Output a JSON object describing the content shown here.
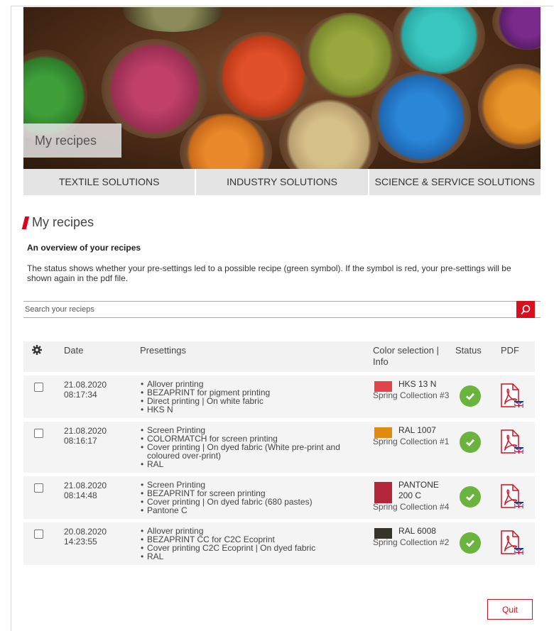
{
  "hero": {
    "title": "My recipes"
  },
  "nav": {
    "items": [
      "TEXTILE SOLUTIONS",
      "INDUSTRY SOLUTIONS",
      "SCIENCE & SERVICE SOLUTIONS"
    ]
  },
  "page": {
    "heading": "My recipes",
    "subtitle": "An overview of your recipes",
    "description": "The status shows whether your pre-settings led to a possible recipe (green symbol). If the symbol is red, your pre-settings will be shown again in the pdf file."
  },
  "search": {
    "placeholder": "Search your recieps",
    "icon": "search-icon"
  },
  "table": {
    "headers": {
      "settings_icon": "gear-icon",
      "date": "Date",
      "presettings": "Presettings",
      "color": "Color selection | Info",
      "status": "Status",
      "pdf": "PDF"
    },
    "rows": [
      {
        "date": "21.08.2020",
        "time": "08:17:34",
        "presettings": [
          "Allover printing",
          "BEZAPRINT for pigment printing",
          "Direct printing | On white fabric",
          "HKS N"
        ],
        "color_code": "HKS 13 N",
        "color_hex": "#e0434a",
        "collection": "Spring Collection #3",
        "status": "ok"
      },
      {
        "date": "21.08.2020",
        "time": "08:16:17",
        "presettings": [
          "Screen Printing",
          "COLORMATCH for screen printing",
          "Cover printing | On dyed fabric (White pre-print and coloured over-print)",
          "RAL"
        ],
        "color_code": "RAL 1007",
        "color_hex": "#e08a10",
        "collection": "Spring Collection #1",
        "status": "ok"
      },
      {
        "date": "21.08.2020",
        "time": "08:14:48",
        "presettings": [
          "Screen Printing",
          "BEZAPRINT for screen printing",
          "Cover printing | On dyed fabric (680 pastes)",
          "Pantone C"
        ],
        "color_code": "PANTONE 200 C",
        "color_hex": "#b3263a",
        "collection": "Spring Collection #4",
        "status": "ok"
      },
      {
        "date": "20.08.2020",
        "time": "14:23:55",
        "presettings": [
          "Allover printing",
          "BEZAPRINT CC for C2C Ecoprint",
          "Cover printing C2C Ecoprint | On dyed fabric",
          "RAL"
        ],
        "color_code": "RAL 6008",
        "color_hex": "#35342b",
        "collection": "Spring Collection #2",
        "status": "ok"
      }
    ]
  },
  "actions": {
    "quit": "Quit"
  },
  "colors": {
    "accent": "#d80f1c",
    "status_ok": "#6ab43e"
  }
}
